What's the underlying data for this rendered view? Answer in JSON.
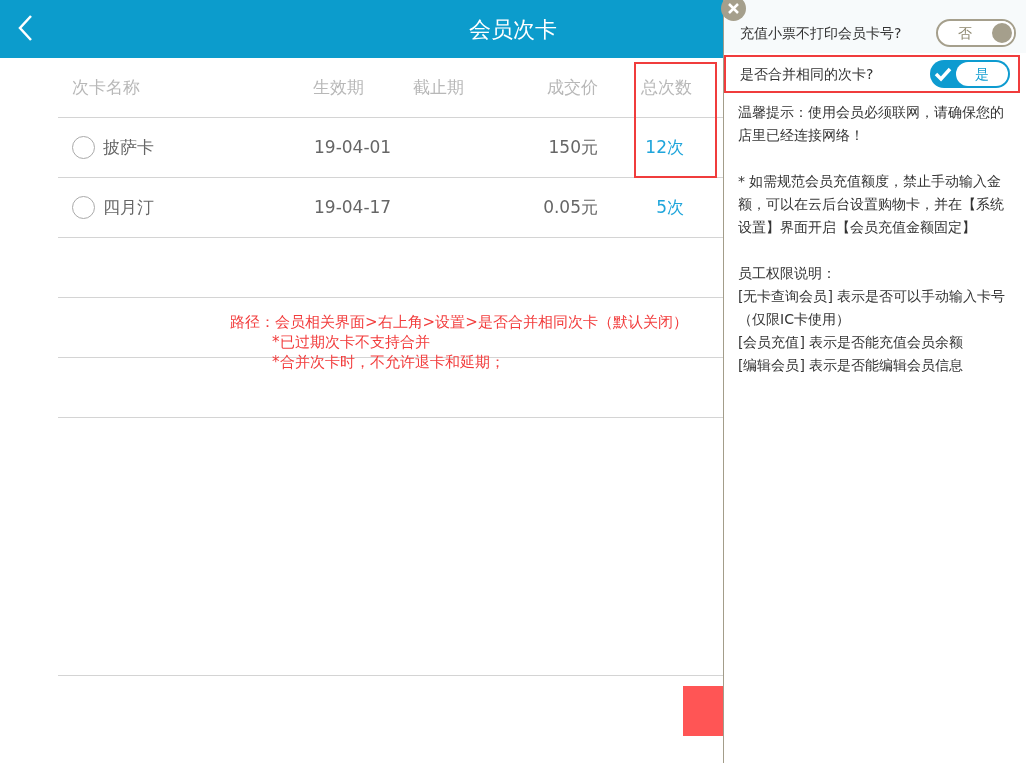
{
  "header": {
    "title": "会员次卡"
  },
  "table": {
    "columns": [
      "次卡名称",
      "生效期",
      "截止期",
      "成交价",
      "总次数"
    ],
    "rows": [
      {
        "name": "披萨卡",
        "start": "19-04-01",
        "price": "150元",
        "count": "12次",
        "selected": false
      },
      {
        "name": "四月汀",
        "start": "19-04-17",
        "price": "0.05元",
        "count": "5次",
        "selected": false
      }
    ]
  },
  "annotation": {
    "lines": [
      "路径：会员相关界面>右上角>设置>是否合并相同次卡（默认关闭）",
      "*已过期次卡不支持合并",
      "*合并次卡时，不允许退卡和延期；"
    ]
  },
  "settings_panel": {
    "toggles": [
      {
        "label": "充值小票不打印会员卡号?",
        "on": false,
        "state_text": "否",
        "highlighted": false
      },
      {
        "label": "是否合并相同的次卡?",
        "on": true,
        "state_text": "是",
        "highlighted": true
      }
    ],
    "paragraphs": [
      "温馨提示：使用会员必须联网，请确保您的店里已经连接网络！",
      "* 如需规范会员充值额度，禁止手动输入金额，可以在云后台设置购物卡，并在【系统设置】界面开启【会员充值金额固定】",
      "员工权限说明：\n[无卡查询会员] 表示是否可以手动输入卡号（仅限IC卡使用）\n[会员充值] 表示是否能充值会员余额\n[编辑会员] 表示是否能编辑会员信息"
    ]
  }
}
